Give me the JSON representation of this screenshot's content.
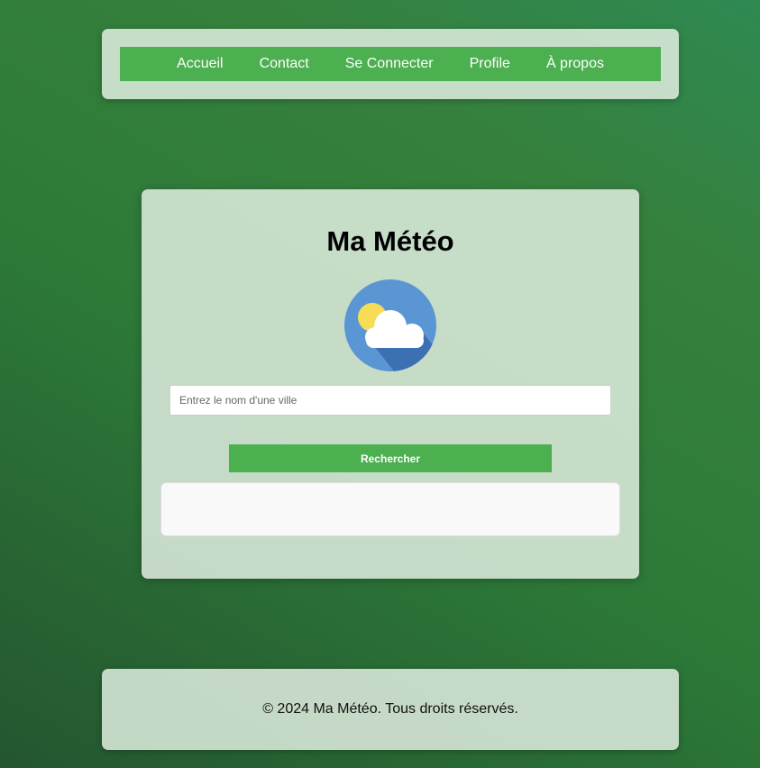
{
  "nav": {
    "items": [
      {
        "label": "Accueil"
      },
      {
        "label": "Contact"
      },
      {
        "label": "Se Connecter"
      },
      {
        "label": "Profile"
      },
      {
        "label": "À propos"
      }
    ]
  },
  "main": {
    "title": "Ma Météo",
    "icon": "sun-cloud-weather-icon",
    "search": {
      "placeholder": "Entrez le nom d'une ville",
      "value": ""
    },
    "search_button_label": "Rechercher",
    "result_text": ""
  },
  "footer": {
    "text": "© 2024 Ma Météo. Tous droits réservés."
  },
  "colors": {
    "accent": "#4caf50",
    "panel": "#e1ede1",
    "icon_circle": "#5b96d4",
    "icon_shadow": "#3d6fb3",
    "sun": "#f7dc55",
    "cloud": "#ffffff"
  }
}
